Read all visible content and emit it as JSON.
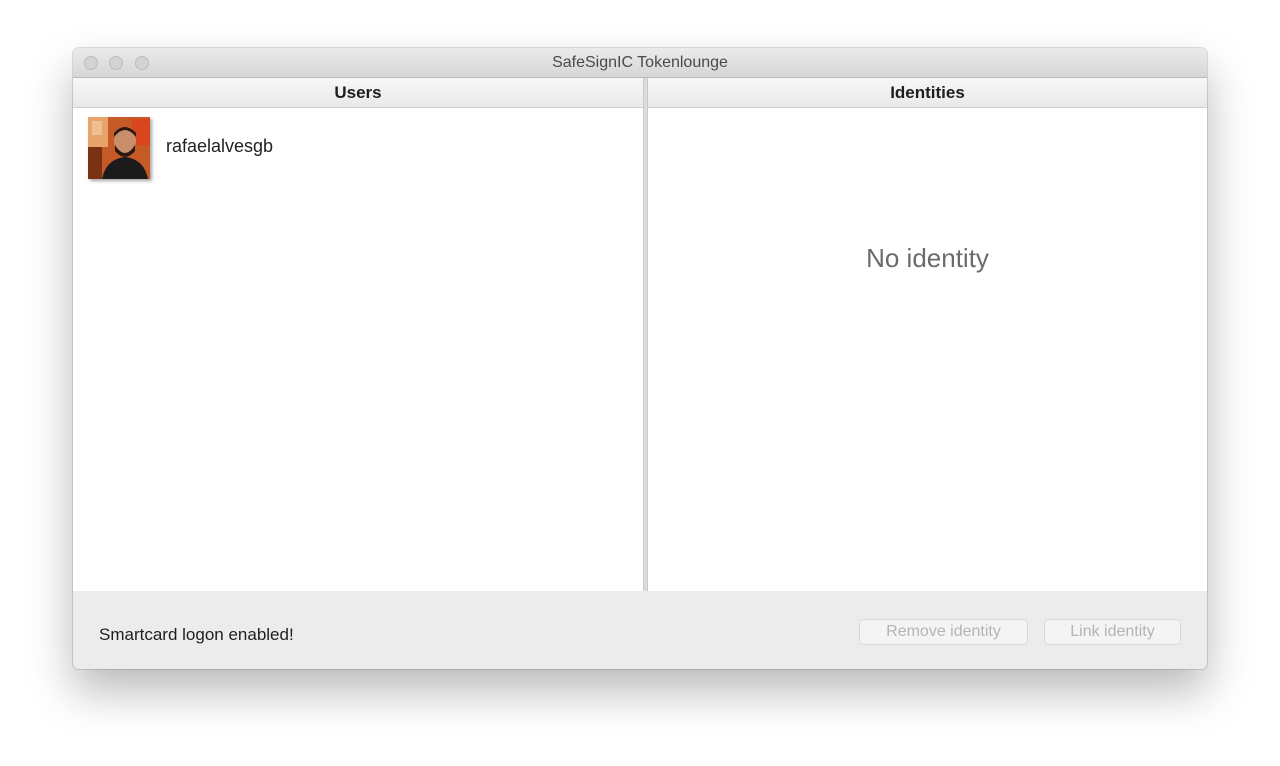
{
  "window": {
    "title": "SafeSignIC Tokenlounge"
  },
  "users_pane": {
    "header": "Users",
    "items": [
      {
        "name": "rafaelalvesgb",
        "avatar": "user-photo"
      }
    ]
  },
  "identities_pane": {
    "header": "Identities",
    "empty_text": "No identity"
  },
  "footer": {
    "status": "Smartcard logon enabled!",
    "remove_button": "Remove identity",
    "link_button": "Link identity"
  },
  "colors": {
    "window_background": "#ececec",
    "disabled_button_text": "#b4b4b4"
  }
}
